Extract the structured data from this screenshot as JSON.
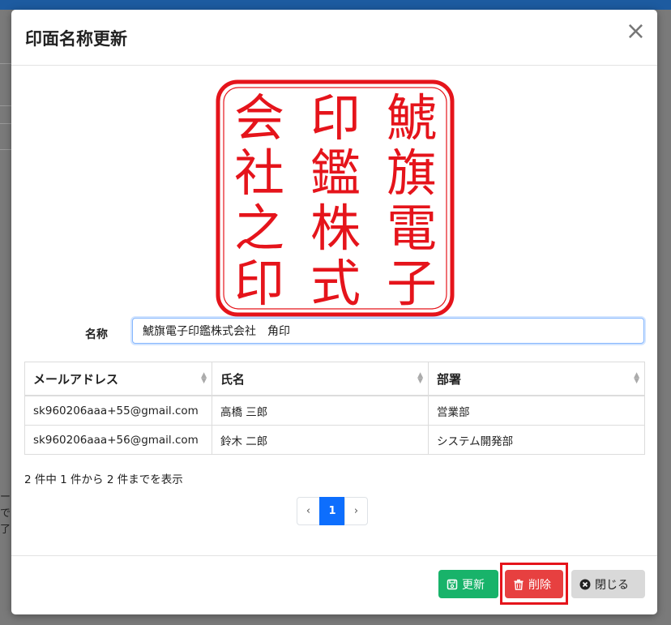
{
  "background": {
    "partial_texts": [
      "ー",
      "で",
      "了"
    ]
  },
  "modal": {
    "title": "印面名称更新",
    "close_glyph": "×"
  },
  "seal": {
    "color": "#e5141b",
    "characters": "鯱旗電子印鑑株式会社",
    "column_right": [
      "鯱",
      "旗",
      "電",
      "子"
    ],
    "column_middle": [
      "印",
      "鑑",
      "株",
      "式"
    ],
    "column_left": [
      "会",
      "社",
      "之",
      "印"
    ]
  },
  "form": {
    "name_label": "名称",
    "name_value": "鯱旗電子印鑑株式会社　角印"
  },
  "table": {
    "columns": [
      "メールアドレス",
      "氏名",
      "部署"
    ],
    "rows": [
      [
        "sk960206aaa+55@gmail.com",
        "高橋 三郎",
        "営業部"
      ],
      [
        "sk960206aaa+56@gmail.com",
        "鈴木 二郎",
        "システム開発部"
      ]
    ]
  },
  "pagination": {
    "info": "2 件中 1 件から 2 件までを表示",
    "prev": "‹",
    "current": "1",
    "next": "›"
  },
  "buttons": {
    "update": "更新",
    "delete": "削除",
    "close": "閉じる"
  },
  "colors": {
    "update": "#18b36a",
    "delete": "#e74040",
    "highlight_frame": "#e5141b",
    "pager_active": "#0d6efd"
  }
}
